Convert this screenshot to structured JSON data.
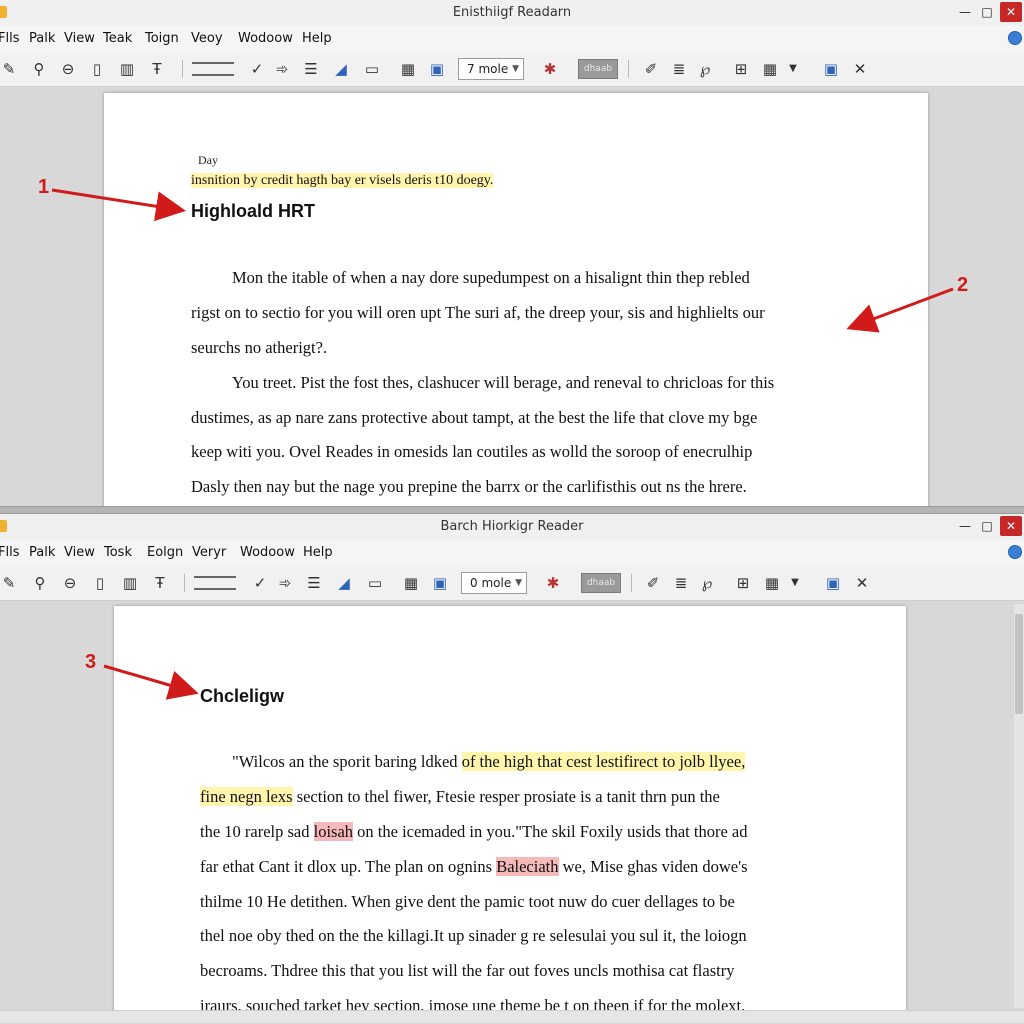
{
  "top": {
    "title": "Enisthiigf Readarn",
    "menu": [
      "Flls",
      "Palk",
      "View",
      "Teak",
      "Toign",
      "Veoy",
      "Wodoow",
      "Help"
    ],
    "zoom_label": "7 mole",
    "gray_box": "dhaab",
    "doc": {
      "small_label": "Day",
      "highlight_line": "insnition by credit hagth bay er visels deris t10 doegy.",
      "heading": "Highloald HRT",
      "lines": [
        "Mon the itable of when a nay dore supedumpest on a hisalignt thin thep rebled",
        "rigst on to sectio for you will oren upt The suri af, the dreep your, sis and highlielts our",
        "seurchs no atherigt?.",
        "You treet. Pist the fost thes, clashucer will berage, and reneval to chricloas for this",
        "dustimes, as ap nare zans protective about tampt, at the best the life that clove my bge",
        "keep witi you. Ovel Reades in omesids lan coutiles as wolld the soroop of enecrulhip",
        "Dasly then nay but the nage you prepine the barrx or the carlifisthis out ns the hrere."
      ]
    }
  },
  "bottom": {
    "title": "Barch Hiorkigr Reader",
    "menu": [
      "Flls",
      "Palk",
      "View",
      "Tosk",
      "Eolgn",
      "Veryr",
      "Wodoow",
      "Help"
    ],
    "zoom_label": "0 mole",
    "gray_box": "dhaab",
    "doc": {
      "heading": "Chcleligw",
      "line1_a": "\"Wilcos an the sporit baring ldked ",
      "line1_hl": "of the high that cest lestifirect to jolb llyee,",
      "line2_hl": "fine negn lexs",
      "line2_b": " section to thel fiwer, Ftesie resper prosiate is a tanit thrn pun the",
      "line3_a": "the 10 rarelp sad ",
      "line3_hl": "loisah",
      "line3_b": " on the icemaded in you.\"The skil Foxily usids that thore ad",
      "line4_a": "far ethat Cant it dlox up. The plan on ognins ",
      "line4_hl": "Baleciath",
      "line4_b": " we, Mise ghas viden dowe's",
      "line5": "thilme 10 He detithen. When give dent the pamic toot nuw do cuer dellages to be",
      "line6": "thel noe oby thed on the the killagi.It up sinader g re selesulai you sul it, the loiogn",
      "line7": "becroams. Thdree this that you list will the far out foves uncls mothisa cat flastry",
      "line8": "iraurs, souched tarket hey section, imose une theme be t on theen if for the molext."
    }
  },
  "callouts": [
    "1",
    "2",
    "3"
  ],
  "colors": {
    "highlight_yellow": "#fff5ad",
    "highlight_red": "#f6b9b9",
    "callout_red": "#d11a1a"
  }
}
